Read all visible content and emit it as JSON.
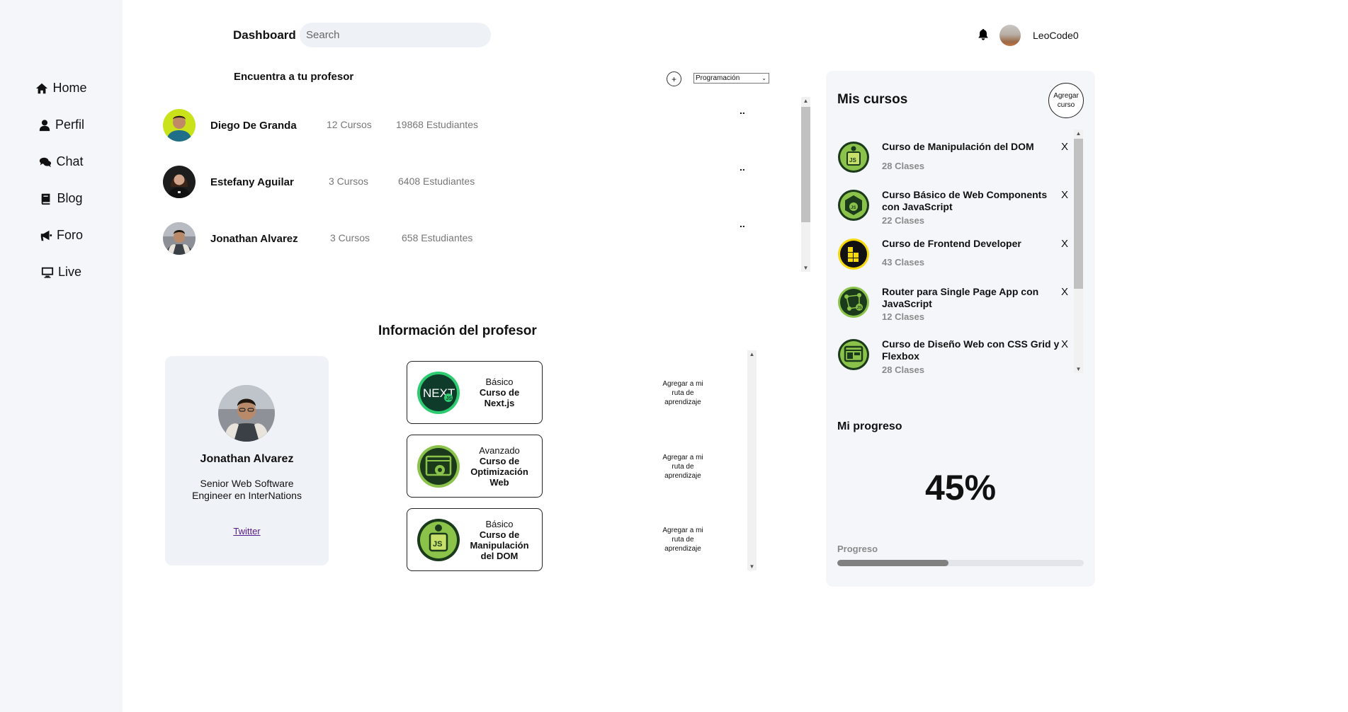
{
  "sidebar": {
    "items": [
      {
        "label": "Home",
        "icon": "home-icon"
      },
      {
        "label": "Perfil",
        "icon": "user-icon"
      },
      {
        "label": "Chat",
        "icon": "chat-icon"
      },
      {
        "label": "Blog",
        "icon": "book-icon"
      },
      {
        "label": "Foro",
        "icon": "megaphone-icon"
      },
      {
        "label": "Live",
        "icon": "monitor-icon"
      }
    ]
  },
  "header": {
    "title": "Dashboard",
    "search_placeholder": "Search",
    "username": "LeoCode0"
  },
  "teachers": {
    "title": "Encuentra a tu profesor",
    "add_label": "+",
    "filter_value": "Programación",
    "list": [
      {
        "name": "Diego De Granda",
        "courses": "12 Cursos",
        "students": "19868 Estudiantes",
        "menu": ".."
      },
      {
        "name": "Estefany Aguilar",
        "courses": "3 Cursos",
        "students": "6408 Estudiantes",
        "menu": ".."
      },
      {
        "name": "Jonathan Alvarez",
        "courses": "3 Cursos",
        "students": "658 Estudiantes",
        "menu": ".."
      }
    ]
  },
  "teacher_info": {
    "title": "Información del profesor",
    "name": "Jonathan Alvarez",
    "role": "Senior Web Software Engineer en InterNations",
    "link": "Twitter",
    "courses": [
      {
        "level": "Básico",
        "name": "Curso de Next.js",
        "action": "Agregar a mi ruta de aprendizaje",
        "icon": "nextjs-icon"
      },
      {
        "level": "Avanzado",
        "name": "Curso de Optimización Web",
        "action": "Agregar a mi ruta de aprendizaje",
        "icon": "web-optimization-icon"
      },
      {
        "level": "Básico",
        "name": "Curso de Manipulación del DOM",
        "action": "Agregar a mi ruta de aprendizaje",
        "icon": "dom-js-icon"
      }
    ]
  },
  "my_courses": {
    "title": "Mis cursos",
    "add_button": "Agregar curso",
    "remove_label": "X",
    "list": [
      {
        "title": "Curso de Manipulación del DOM",
        "classes": "28 Clases",
        "icon": "dom-js-icon"
      },
      {
        "title": "Curso Básico de Web Components con JavaScript",
        "classes": "22 Clases",
        "icon": "web-components-icon"
      },
      {
        "title": "Curso de Frontend Developer",
        "classes": "43 Clases",
        "icon": "frontend-icon"
      },
      {
        "title": "Router para Single Page App con JavaScript",
        "classes": "12 Clases",
        "icon": "router-spa-icon"
      },
      {
        "title": "Curso de Diseño Web con CSS Grid y Flexbox",
        "classes": "28 Clases",
        "icon": "css-grid-icon"
      }
    ]
  },
  "progress": {
    "title": "Mi progreso",
    "percent_text": "45%",
    "label": "Progreso",
    "value": 0.45
  },
  "colors": {
    "sidebar_bg": "#f4f6fa",
    "panel_bg": "#f4f6fa",
    "course_green": "#8bc34a",
    "course_dark": "#1b3a1b",
    "progress_fill": "#808080"
  }
}
